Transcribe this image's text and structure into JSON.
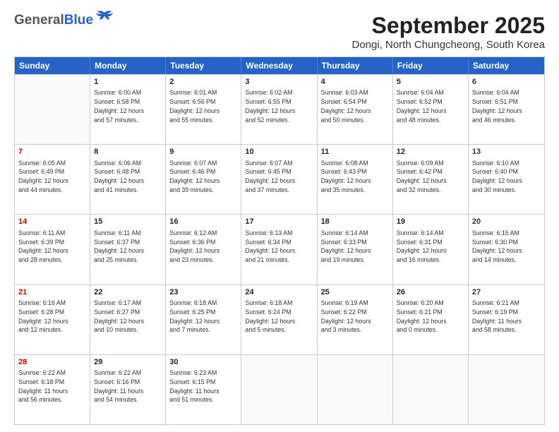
{
  "header": {
    "logo": {
      "part1": "General",
      "part2": "Blue"
    },
    "title": "September 2025",
    "subtitle": "Dongi, North Chungcheong, South Korea"
  },
  "calendar": {
    "days": [
      "Sunday",
      "Monday",
      "Tuesday",
      "Wednesday",
      "Thursday",
      "Friday",
      "Saturday"
    ],
    "rows": [
      [
        {
          "day": "",
          "info": ""
        },
        {
          "day": "1",
          "info": "Sunrise: 6:00 AM\nSunset: 6:58 PM\nDaylight: 12 hours\nand 57 minutes."
        },
        {
          "day": "2",
          "info": "Sunrise: 6:01 AM\nSunset: 6:56 PM\nDaylight: 12 hours\nand 55 minutes."
        },
        {
          "day": "3",
          "info": "Sunrise: 6:02 AM\nSunset: 6:55 PM\nDaylight: 12 hours\nand 52 minutes."
        },
        {
          "day": "4",
          "info": "Sunrise: 6:03 AM\nSunset: 6:54 PM\nDaylight: 12 hours\nand 50 minutes."
        },
        {
          "day": "5",
          "info": "Sunrise: 6:04 AM\nSunset: 6:52 PM\nDaylight: 12 hours\nand 48 minutes."
        },
        {
          "day": "6",
          "info": "Sunrise: 6:04 AM\nSunset: 6:51 PM\nDaylight: 12 hours\nand 46 minutes."
        }
      ],
      [
        {
          "day": "7",
          "info": "Sunrise: 6:05 AM\nSunset: 6:49 PM\nDaylight: 12 hours\nand 44 minutes."
        },
        {
          "day": "8",
          "info": "Sunrise: 6:06 AM\nSunset: 6:48 PM\nDaylight: 12 hours\nand 41 minutes."
        },
        {
          "day": "9",
          "info": "Sunrise: 6:07 AM\nSunset: 6:46 PM\nDaylight: 12 hours\nand 39 minutes."
        },
        {
          "day": "10",
          "info": "Sunrise: 6:07 AM\nSunset: 6:45 PM\nDaylight: 12 hours\nand 37 minutes."
        },
        {
          "day": "11",
          "info": "Sunrise: 6:08 AM\nSunset: 6:43 PM\nDaylight: 12 hours\nand 35 minutes."
        },
        {
          "day": "12",
          "info": "Sunrise: 6:09 AM\nSunset: 6:42 PM\nDaylight: 12 hours\nand 32 minutes."
        },
        {
          "day": "13",
          "info": "Sunrise: 6:10 AM\nSunset: 6:40 PM\nDaylight: 12 hours\nand 30 minutes."
        }
      ],
      [
        {
          "day": "14",
          "info": "Sunrise: 6:11 AM\nSunset: 6:39 PM\nDaylight: 12 hours\nand 28 minutes."
        },
        {
          "day": "15",
          "info": "Sunrise: 6:11 AM\nSunset: 6:37 PM\nDaylight: 12 hours\nand 25 minutes."
        },
        {
          "day": "16",
          "info": "Sunrise: 6:12 AM\nSunset: 6:36 PM\nDaylight: 12 hours\nand 23 minutes."
        },
        {
          "day": "17",
          "info": "Sunrise: 6:13 AM\nSunset: 6:34 PM\nDaylight: 12 hours\nand 21 minutes."
        },
        {
          "day": "18",
          "info": "Sunrise: 6:14 AM\nSunset: 6:33 PM\nDaylight: 12 hours\nand 19 minutes."
        },
        {
          "day": "19",
          "info": "Sunrise: 6:14 AM\nSunset: 6:31 PM\nDaylight: 12 hours\nand 16 minutes."
        },
        {
          "day": "20",
          "info": "Sunrise: 6:15 AM\nSunset: 6:30 PM\nDaylight: 12 hours\nand 14 minutes."
        }
      ],
      [
        {
          "day": "21",
          "info": "Sunrise: 6:16 AM\nSunset: 6:28 PM\nDaylight: 12 hours\nand 12 minutes."
        },
        {
          "day": "22",
          "info": "Sunrise: 6:17 AM\nSunset: 6:27 PM\nDaylight: 12 hours\nand 10 minutes."
        },
        {
          "day": "23",
          "info": "Sunrise: 6:18 AM\nSunset: 6:25 PM\nDaylight: 12 hours\nand 7 minutes."
        },
        {
          "day": "24",
          "info": "Sunrise: 6:18 AM\nSunset: 6:24 PM\nDaylight: 12 hours\nand 5 minutes."
        },
        {
          "day": "25",
          "info": "Sunrise: 6:19 AM\nSunset: 6:22 PM\nDaylight: 12 hours\nand 3 minutes."
        },
        {
          "day": "26",
          "info": "Sunrise: 6:20 AM\nSunset: 6:21 PM\nDaylight: 12 hours\nand 0 minutes."
        },
        {
          "day": "27",
          "info": "Sunrise: 6:21 AM\nSunset: 6:19 PM\nDaylight: 11 hours\nand 58 minutes."
        }
      ],
      [
        {
          "day": "28",
          "info": "Sunrise: 6:22 AM\nSunset: 6:18 PM\nDaylight: 11 hours\nand 56 minutes."
        },
        {
          "day": "29",
          "info": "Sunrise: 6:22 AM\nSunset: 6:16 PM\nDaylight: 11 hours\nand 54 minutes."
        },
        {
          "day": "30",
          "info": "Sunrise: 6:23 AM\nSunset: 6:15 PM\nDaylight: 11 hours\nand 51 minutes."
        },
        {
          "day": "",
          "info": ""
        },
        {
          "day": "",
          "info": ""
        },
        {
          "day": "",
          "info": ""
        },
        {
          "day": "",
          "info": ""
        }
      ]
    ]
  }
}
